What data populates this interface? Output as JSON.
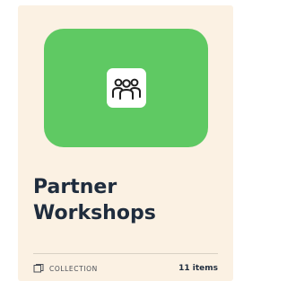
{
  "card": {
    "title": "Partner Workshops",
    "thumbnail_color": "#5fc963",
    "thumbnail_icon": "people-group-icon",
    "type_icon": "collection-icon",
    "type_label": "COLLECTION",
    "count_label": "11 items"
  }
}
